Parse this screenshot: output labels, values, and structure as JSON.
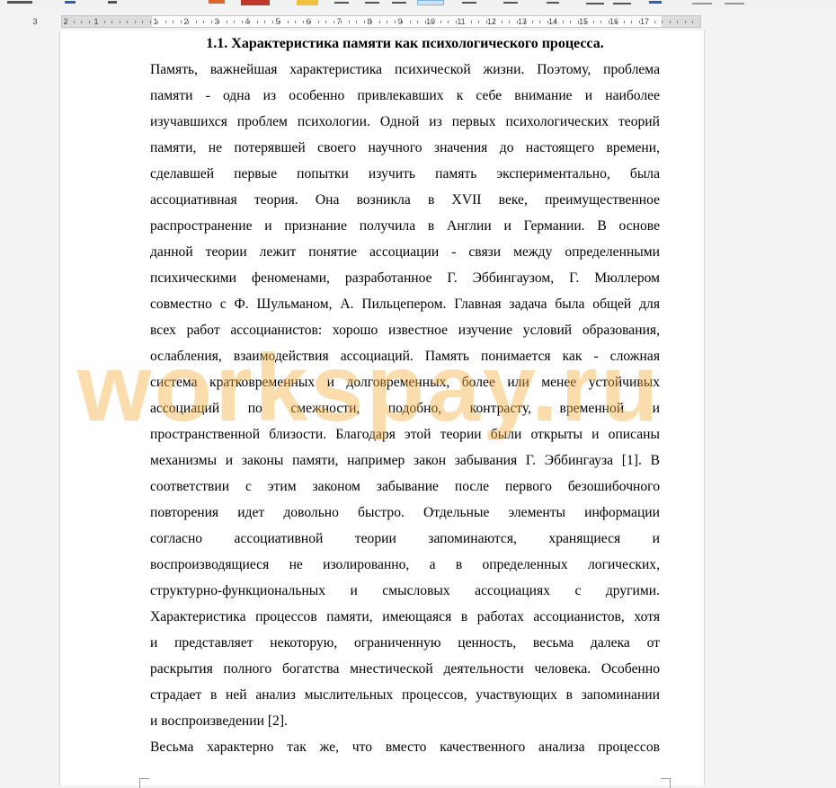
{
  "ruler": {
    "numbers": [
      "3",
      "2",
      "1",
      "1",
      "2",
      "3",
      "4",
      "5",
      "6",
      "7",
      "8",
      "9",
      "10",
      "11",
      "12",
      "13",
      "14",
      "15",
      "16",
      "17"
    ]
  },
  "document": {
    "heading": "1.1.   Характеристика памяти как психологического процесса.",
    "paragraph1": [
      "Память, важнейшая характеристика психической жизни. Поэтому, проблема",
      "памяти - одна из особенно привлекавших к себе внимание и наиболее",
      "изучавшихся проблем психологии. Одной из первых психологических теорий",
      "памяти, не потерявшей своего научного значения до настоящего времени,",
      "сделавшей первые попытки изучить память экспериментально, была",
      "ассоциативная теория. Она возникла в XVII веке, преимущественное",
      "распространение и признание получила в Англии и Германии. В основе",
      "данной теории лежит понятие ассоциации - связи между определенными",
      "психическими феноменами, разработанное Г. Эббингаузом, Г. Мюллером",
      "совместно с Ф. Шульманом, А. Пильцепером. Главная задача была общей для",
      "всех работ ассоцианистов: хорошо известное изучение условий образования,",
      "ослабления, взаимодействия ассоциаций. Память понимается как - сложная",
      "система кратковременных и долговременных, более или менее устойчивых",
      "ассоциаций по смежности, подобно, контрасту, временной и",
      "пространственной близости. Благодаря этой теории были открыты и описаны",
      "механизмы и законы памяти, например закон забывания Г. Эббингауза [1]. В",
      "соответствии с этим законом забывание после первого безошибочного",
      "повторения идет довольно быстро. Отдельные элементы информации",
      "согласно ассоциативной теории запоминаются, хранящиеся и",
      "воспроизводящиеся не изолированно, а в определенных логических,",
      "структурно-функциональных и смысловых ассоциациях с другими.",
      "Характеристика процессов памяти, имеющаяся в работах ассоцианистов, хотя",
      "и представляет некоторую, ограниченную ценность, весьма далека от",
      "раскрытия полного богатства мнестической деятельности человека. Особенно",
      "страдает в ней анализ мыслительных процессов, участвующих в запоминании",
      "и воспроизведении [2]."
    ],
    "paragraph2": [
      "Весьма характерно так же, что вместо качественного анализа процессов"
    ]
  },
  "watermark": "workspay.ru",
  "colors": {
    "watermark": "#f5af3c",
    "page": "#ffffff",
    "background": "#f3f3f3"
  }
}
